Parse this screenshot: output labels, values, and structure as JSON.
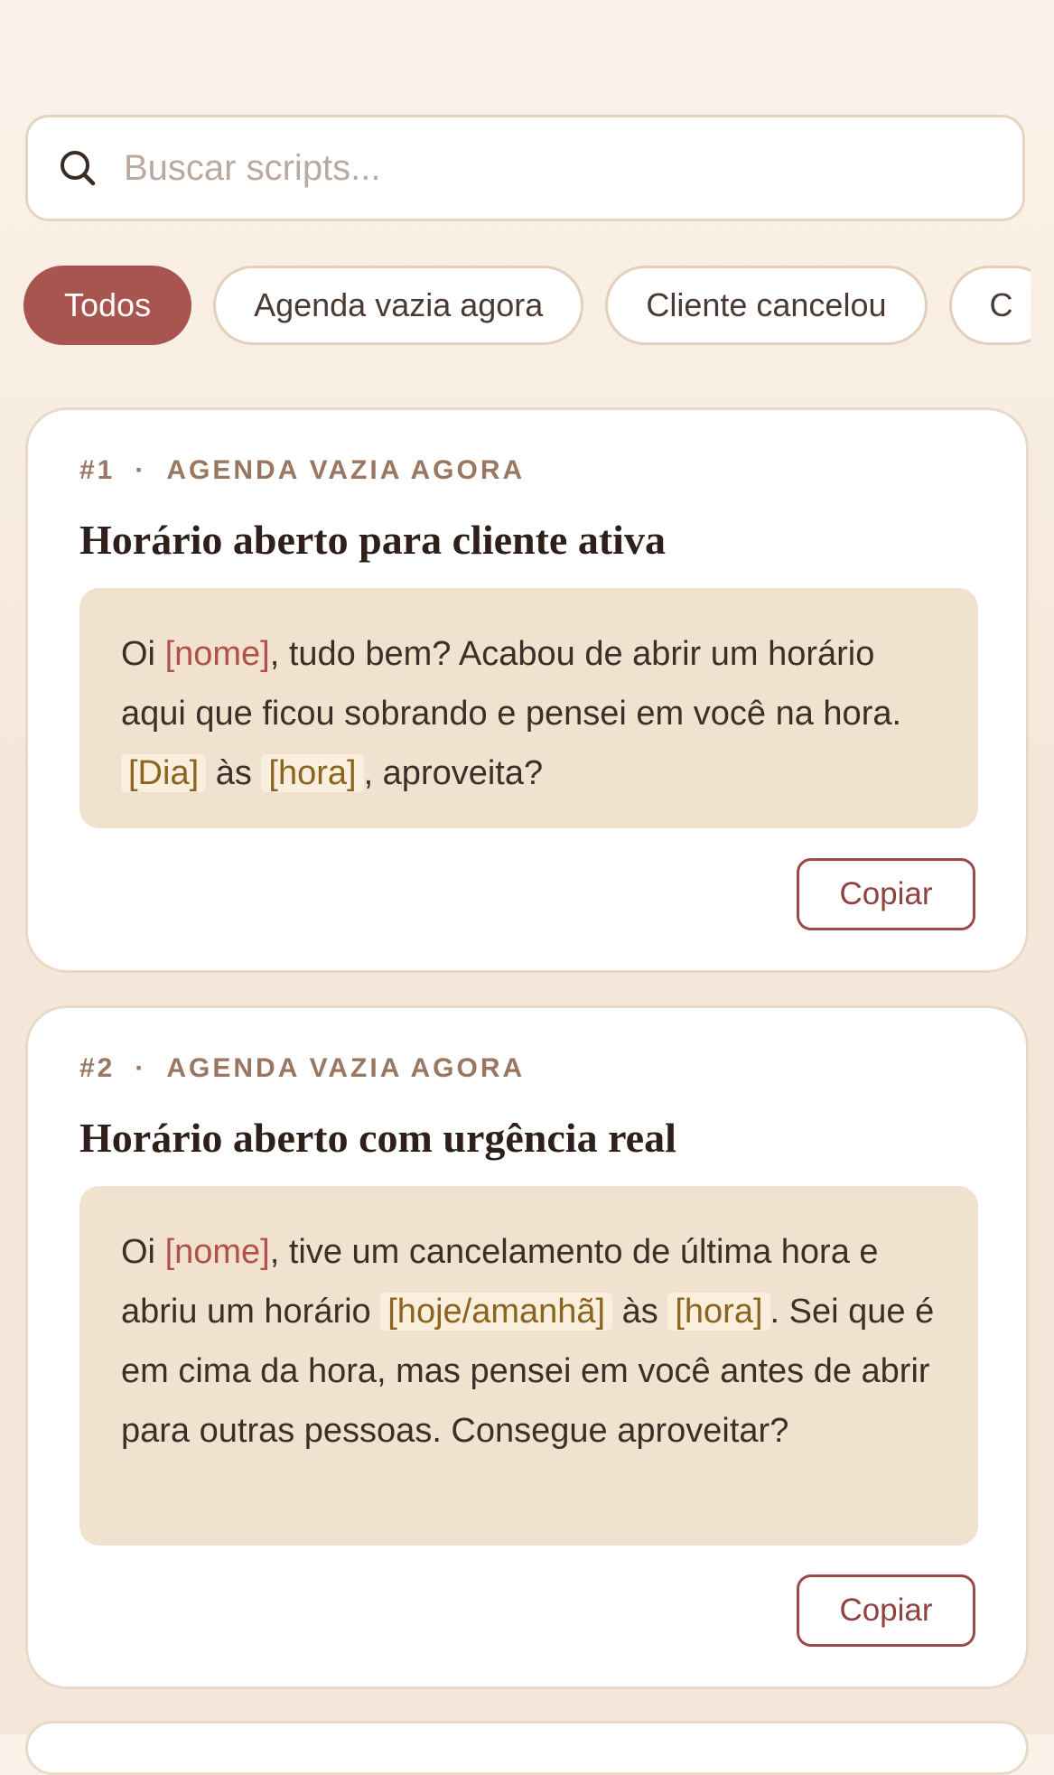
{
  "search": {
    "placeholder": "Buscar scripts..."
  },
  "filters": [
    {
      "label": "Todos",
      "active": true
    },
    {
      "label": "Agenda vazia agora",
      "active": false
    },
    {
      "label": "Cliente cancelou",
      "active": false
    },
    {
      "label": "C",
      "active": false
    }
  ],
  "cards": [
    {
      "number": "#1",
      "category": "AGENDA VAZIA AGORA",
      "title": "Horário aberto para cliente ativa",
      "body": {
        "t1": "Oi ",
        "v1": "[nome]",
        "t2": ", tudo bem? Acabou de abrir um horário aqui que ficou sobrando e pensei em você na hora. ",
        "v2": "[Dia]",
        "t3": " às ",
        "v3": "[hora]",
        "t4": ", aproveita?"
      },
      "copy_label": "Copiar"
    },
    {
      "number": "#2",
      "category": "AGENDA VAZIA AGORA",
      "title": "Horário aberto com urgência real",
      "body": {
        "t1": "Oi ",
        "v1": "[nome]",
        "t2": ", tive um cancelamento de última hora e abriu um horário ",
        "v2": "[hoje/amanhã]",
        "t3": " às ",
        "v3": "[hora]",
        "t4": ". Sei que é em cima da hora, mas pensei em você antes de abrir para outras pessoas. Consegue aproveitar?"
      },
      "copy_label": "Copiar"
    }
  ],
  "colors": {
    "accent": "#a8544f",
    "variable_name": "#b0514a",
    "variable_highlight": "#8a6420",
    "body_background": "#f1e1cf"
  }
}
